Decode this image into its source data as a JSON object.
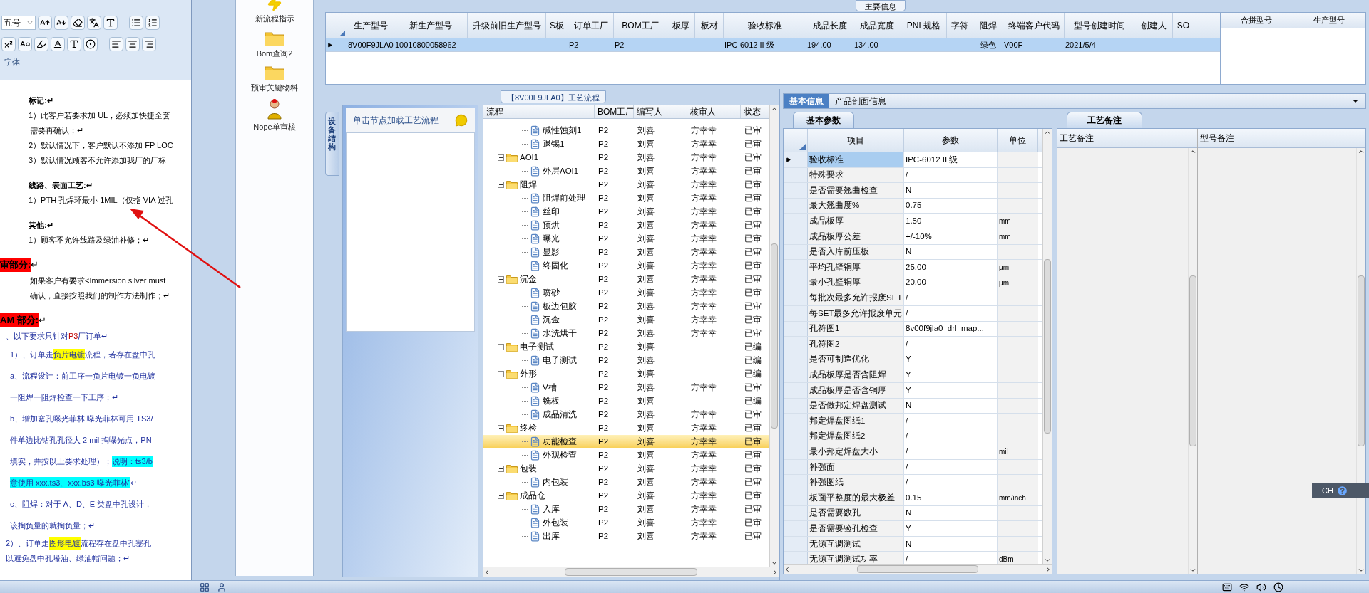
{
  "doc": {
    "font_size": "五号",
    "group_label": "字体",
    "lines": [
      {
        "kind": "heading",
        "segments": [
          {
            "text": "标记:↵",
            "kind": "plain"
          }
        ]
      },
      {
        "kind": "body",
        "segments": [
          {
            "text": "1）此客户若要求加 UL，必须加快捷全套",
            "kind": "plain"
          }
        ]
      },
      {
        "kind": "indent",
        "segments": [
          {
            "text": "需要再确认；↵",
            "kind": "plain"
          }
        ]
      },
      {
        "kind": "body",
        "segments": [
          {
            "text": "2）默认情况下，客户默认不添加 FP LOC",
            "kind": "plain"
          }
        ]
      },
      {
        "kind": "body",
        "segments": [
          {
            "text": "3）默认情况顾客不允许添加我厂的厂标",
            "kind": "plain"
          }
        ]
      },
      {
        "kind": "heading",
        "segments": [
          {
            "text": "线路、表面工艺:↵",
            "kind": "plain"
          }
        ]
      },
      {
        "kind": "body",
        "segments": [
          {
            "text": "1）PTH 孔焊环最小 1MIL（仅指 VIA 过孔",
            "kind": "plain"
          }
        ]
      },
      {
        "kind": "heading",
        "segments": [
          {
            "text": "其他:↵",
            "kind": "plain"
          }
        ]
      },
      {
        "kind": "body",
        "segments": [
          {
            "text": "1）顾客不允许线路及绿油补修；↵",
            "kind": "plain"
          }
        ]
      },
      {
        "kind": "section",
        "segments": [
          {
            "text": "审部分:",
            "kind": "red"
          },
          {
            "text": "↵",
            "kind": "plain"
          }
        ]
      },
      {
        "kind": "indent",
        "segments": [
          {
            "text": "如果客户有要求<Immersion silver must",
            "kind": "plain"
          }
        ]
      },
      {
        "kind": "indent",
        "segments": [
          {
            "text": "确认，直接按照我们的制作方法制作；↵",
            "kind": "plain"
          }
        ]
      },
      {
        "kind": "section",
        "segments": [
          {
            "text": "AM 部分:",
            "kind": "red"
          },
          {
            "text": "↵",
            "kind": "plain"
          }
        ]
      },
      {
        "kind": "blue",
        "segments": [
          {
            "text": "、以下要求只针对 ",
            "kind": "plain"
          },
          {
            "text": "P3",
            "kind": "redtext"
          },
          {
            "text": " 厂订单↵",
            "kind": "plain"
          }
        ]
      },
      {
        "kind": "bluewide",
        "segments": [
          {
            "text": "1）、订单走",
            "kind": "plain"
          },
          {
            "text": "负片电镀",
            "kind": "yellow"
          },
          {
            "text": "流程，若存在盘中孔",
            "kind": "plain"
          }
        ]
      },
      {
        "kind": "bluewide",
        "segments": [
          {
            "text": "a、流程设计：前工序一负片电镀一负电镀",
            "kind": "plain"
          }
        ]
      },
      {
        "kind": "bluewide",
        "segments": [
          {
            "text": "一阻焊一阻焊检查一下工序；↵",
            "kind": "plain"
          }
        ]
      },
      {
        "kind": "bluewide",
        "segments": [
          {
            "text": "b、增加塞孔曝光菲林,曝光菲林可用 TS3/",
            "kind": "plain"
          }
        ]
      },
      {
        "kind": "bluewide",
        "segments": [
          {
            "text": "件单边比钻孔孔径大 2 mil 掏曝光点，PN",
            "kind": "plain"
          }
        ]
      },
      {
        "kind": "bluewide",
        "segments": [
          {
            "text": "填实，并按以上要求处理）；",
            "kind": "plain"
          },
          {
            "text": "说明：ts3/b",
            "kind": "cyan"
          }
        ]
      },
      {
        "kind": "bluewide",
        "segments": [
          {
            "text": "意使用 xxx.ts3、xxx.bs3 曝光菲林”",
            "kind": "cyan"
          },
          {
            "text": "↵",
            "kind": "plain"
          }
        ]
      },
      {
        "kind": "bluewide",
        "segments": [
          {
            "text": "c、阻焊：对于 A、D、E 类盘中孔设计，",
            "kind": "plain"
          }
        ]
      },
      {
        "kind": "bluewide",
        "segments": [
          {
            "text": "该掏负量的就掏负量；↵",
            "kind": "plain"
          }
        ]
      },
      {
        "kind": "blue",
        "segments": [
          {
            "text": "2）、订单走",
            "kind": "plain"
          },
          {
            "text": "图形电镀",
            "kind": "yellow"
          },
          {
            "text": "流程存在盘中孔塞孔",
            "kind": "plain"
          }
        ]
      },
      {
        "kind": "blue",
        "segments": [
          {
            "text": "以避免盘中孔曝油、绿油帽问题；↵",
            "kind": "plain"
          }
        ]
      }
    ]
  },
  "toolbar": [
    {
      "label": "新流程指示",
      "kind": "bolt"
    },
    {
      "label": "Bom查询2",
      "kind": "folder"
    },
    {
      "label": "预审关键物料",
      "kind": "folder"
    },
    {
      "label": "Nope单审核",
      "kind": "person"
    }
  ],
  "main_info": {
    "title": "主要信息",
    "columns": [
      "生产型号",
      "新生产型号",
      "升级前旧生产型号",
      "S板",
      "订单工厂",
      "BOM工厂",
      "板厚",
      "板材",
      "验收标准",
      "成品长度",
      "成品宽度",
      "PNL规格",
      "字符",
      "阻焊",
      "终端客户代码",
      "型号创建时间",
      "创建人",
      "SO"
    ],
    "rows": [
      {
        "selected": true,
        "cells": [
          "8V00F9JLA0",
          "10010800058962",
          null,
          null,
          "P2",
          "P2",
          null,
          null,
          "IPC-6012 II 级",
          "194.00",
          "134.00",
          null,
          null,
          "绿色",
          "V00F",
          "2021/5/4",
          null,
          null
        ]
      }
    ],
    "merge_columns": [
      "合拼型号",
      "生产型号"
    ]
  },
  "flow": {
    "title": "【8V00F9JLA0】工艺流程",
    "side_tab": "设备结构",
    "hint": "单击节点加载工艺流程",
    "columns": [
      "流程",
      "BOM工厂",
      "编写人",
      "核审人",
      "状态"
    ],
    "tree": [
      {
        "children": [
          {
            "name": "碱性蚀刻1",
            "bom": "P2",
            "writer": "刘喜",
            "reviewer": "方幸幸",
            "status": "已审",
            "selected": false
          },
          {
            "name": "退锡1",
            "bom": "P2",
            "writer": "刘喜",
            "reviewer": "方幸幸",
            "status": "已审",
            "selected": false
          }
        ]
      },
      {
        "name": "AOI1",
        "bom": "P2",
        "writer": "刘喜",
        "reviewer": "方幸幸",
        "status": "已审",
        "selected": false,
        "expanded": true,
        "children": [
          {
            "name": "外层AOI1",
            "bom": "P2",
            "writer": "刘喜",
            "reviewer": "方幸幸",
            "status": "已审",
            "selected": false
          }
        ]
      },
      {
        "name": "阻焊",
        "bom": "P2",
        "writer": "刘喜",
        "reviewer": "方幸幸",
        "status": "已审",
        "selected": false,
        "expanded": true,
        "children": [
          {
            "name": "阻焊前处理",
            "bom": "P2",
            "writer": "刘喜",
            "reviewer": "方幸幸",
            "status": "已审",
            "selected": false
          },
          {
            "name": "丝印",
            "bom": "P2",
            "writer": "刘喜",
            "reviewer": "方幸幸",
            "status": "已审",
            "selected": false
          },
          {
            "name": "预烘",
            "bom": "P2",
            "writer": "刘喜",
            "reviewer": "方幸幸",
            "status": "已审",
            "selected": false
          },
          {
            "name": "曝光",
            "bom": "P2",
            "writer": "刘喜",
            "reviewer": "方幸幸",
            "status": "已审",
            "selected": false
          },
          {
            "name": "显影",
            "bom": "P2",
            "writer": "刘喜",
            "reviewer": "方幸幸",
            "status": "已审",
            "selected": false
          },
          {
            "name": "终固化",
            "bom": "P2",
            "writer": "刘喜",
            "reviewer": "方幸幸",
            "status": "已审",
            "selected": false
          }
        ]
      },
      {
        "name": "沉金",
        "bom": "P2",
        "writer": "刘喜",
        "reviewer": "方幸幸",
        "status": "已审",
        "selected": false,
        "expanded": true,
        "children": [
          {
            "name": "喷砂",
            "bom": "P2",
            "writer": "刘喜",
            "reviewer": "方幸幸",
            "status": "已审",
            "selected": false
          },
          {
            "name": "板边包胶",
            "bom": "P2",
            "writer": "刘喜",
            "reviewer": "方幸幸",
            "status": "已审",
            "selected": false
          },
          {
            "name": "沉金",
            "bom": "P2",
            "writer": "刘喜",
            "reviewer": "方幸幸",
            "status": "已审",
            "selected": false
          },
          {
            "name": "水洗烘干",
            "bom": "P2",
            "writer": "刘喜",
            "reviewer": "方幸幸",
            "status": "已审",
            "selected": false
          }
        ]
      },
      {
        "name": "电子测试",
        "bom": "P2",
        "writer": "刘喜",
        "status": "已编",
        "selected": false,
        "expanded": true,
        "children": [
          {
            "name": "电子测试",
            "bom": "P2",
            "writer": "刘喜",
            "status": "已编",
            "selected": false
          }
        ]
      },
      {
        "name": "外形",
        "bom": "P2",
        "writer": "刘喜",
        "status": "已编",
        "selected": false,
        "expanded": true,
        "children": [
          {
            "name": "V槽",
            "bom": "P2",
            "writer": "刘喜",
            "reviewer": "方幸幸",
            "status": "已审",
            "selected": false
          },
          {
            "name": "铣板",
            "bom": "P2",
            "writer": "刘喜",
            "status": "已编",
            "selected": false
          },
          {
            "name": "成品清洗",
            "bom": "P2",
            "writer": "刘喜",
            "reviewer": "方幸幸",
            "status": "已审",
            "selected": false
          }
        ]
      },
      {
        "name": "终检",
        "bom": "P2",
        "writer": "刘喜",
        "reviewer": "方幸幸",
        "status": "已审",
        "selected": false,
        "expanded": true,
        "children": [
          {
            "name": "功能检查",
            "bom": "P2",
            "writer": "刘喜",
            "reviewer": "方幸幸",
            "status": "已审",
            "selected": true
          },
          {
            "name": "外观检查",
            "bom": "P2",
            "writer": "刘喜",
            "reviewer": "方幸幸",
            "status": "已审",
            "selected": false
          }
        ]
      },
      {
        "name": "包装",
        "bom": "P2",
        "writer": "刘喜",
        "reviewer": "方幸幸",
        "status": "已审",
        "selected": false,
        "expanded": true,
        "children": [
          {
            "name": "内包装",
            "bom": "P2",
            "writer": "刘喜",
            "reviewer": "方幸幸",
            "status": "已审",
            "selected": false
          }
        ]
      },
      {
        "name": "成品仓",
        "bom": "P2",
        "writer": "刘喜",
        "reviewer": "方幸幸",
        "status": "已审",
        "selected": false,
        "expanded": true,
        "children": [
          {
            "name": "入库",
            "bom": "P2",
            "writer": "刘喜",
            "reviewer": "方幸幸",
            "status": "已审",
            "selected": false
          },
          {
            "name": "外包装",
            "bom": "P2",
            "writer": "刘喜",
            "reviewer": "方幸幸",
            "status": "已审",
            "selected": false
          },
          {
            "name": "出库",
            "bom": "P2",
            "writer": "刘喜",
            "reviewer": "方幸幸",
            "status": "已审",
            "selected": false
          }
        ]
      }
    ]
  },
  "info_tabs": [
    {
      "label": "基本信息",
      "selected": true
    },
    {
      "label": "产品剖面信息",
      "selected": false
    }
  ],
  "params": {
    "tab": "基本参数",
    "columns": [
      "项目",
      "参数",
      "单位"
    ],
    "rows": [
      {
        "item": "验收标准",
        "value": "IPC-6012 II 级",
        "selected": true
      },
      {
        "item": "特殊要求",
        "value": "/",
        "selected": false
      },
      {
        "item": "是否需要翘曲检查",
        "value": "N",
        "selected": false
      },
      {
        "item": "最大翘曲度%",
        "value": "0.75",
        "selected": false
      },
      {
        "item": "成品板厚",
        "value": "1.50",
        "unit": "mm",
        "selected": false
      },
      {
        "item": "成品板厚公差",
        "value": "+/-10%",
        "unit": "mm",
        "selected": false
      },
      {
        "item": "是否入库前压板",
        "value": "N",
        "selected": false
      },
      {
        "item": "平均孔壁铜厚",
        "value": "25.00",
        "unit": "μm",
        "selected": false
      },
      {
        "item": "最小孔壁铜厚",
        "value": "20.00",
        "unit": "μm",
        "selected": false
      },
      {
        "item": "每批次最多允许报废SET",
        "value": "/",
        "selected": false
      },
      {
        "item": "每SET最多允许报废单元",
        "value": "/",
        "selected": false
      },
      {
        "item": "孔符图1",
        "value": "8v00f9jla0_drl_map...",
        "selected": false
      },
      {
        "item": "孔符图2",
        "value": "/",
        "selected": false
      },
      {
        "item": "是否可制造优化",
        "value": "Y",
        "selected": false
      },
      {
        "item": "成品板厚是否含阻焊",
        "value": "Y",
        "selected": false
      },
      {
        "item": "成品板厚是否含铜厚",
        "value": "Y",
        "selected": false
      },
      {
        "item": "是否做邦定焊盘测试",
        "value": "N",
        "selected": false
      },
      {
        "item": "邦定焊盘图纸1",
        "value": "/",
        "selected": false
      },
      {
        "item": "邦定焊盘图纸2",
        "value": "/",
        "selected": false
      },
      {
        "item": "最小邦定焊盘大小",
        "value": "/",
        "unit": "mil",
        "selected": false
      },
      {
        "item": "补强面",
        "value": "/",
        "selected": false
      },
      {
        "item": "补强图纸",
        "value": "/",
        "selected": false
      },
      {
        "item": "板面平整度的最大极差",
        "value": "0.15",
        "unit": "mm/inch",
        "selected": false
      },
      {
        "item": "是否需要数孔",
        "value": "N",
        "selected": false
      },
      {
        "item": "是否需要验孔检查",
        "value": "Y",
        "selected": false
      },
      {
        "item": "无源互调测试",
        "value": "N",
        "selected": false
      },
      {
        "item": "无源互调测试功率",
        "value": "/",
        "unit": "dBm",
        "selected": false
      }
    ]
  },
  "notes": {
    "tab": "工艺备注",
    "columns": [
      "工艺备注",
      "型号备注"
    ]
  },
  "ime": {
    "label": "CH"
  }
}
